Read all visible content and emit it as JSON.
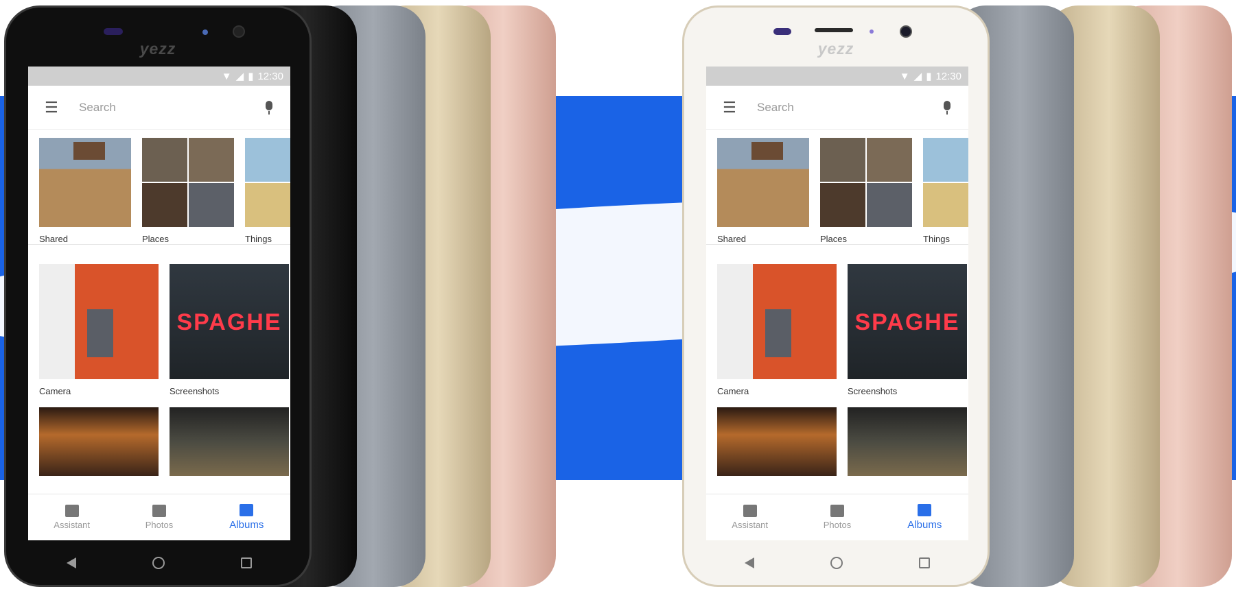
{
  "status_bar": {
    "time": "12:30"
  },
  "brand": "yezz",
  "search": {
    "placeholder": "Search"
  },
  "albums_top": [
    {
      "label": "Shared"
    },
    {
      "label": "Places"
    },
    {
      "label": "Things"
    }
  ],
  "albums_big": [
    {
      "label": "Camera"
    },
    {
      "label": "Screenshots"
    }
  ],
  "screenshot_sign": "SPAGHE",
  "bottom_nav": [
    {
      "label": "Assistant",
      "active": false
    },
    {
      "label": "Photos",
      "active": false
    },
    {
      "label": "Albums",
      "active": true
    }
  ],
  "colors": {
    "accent": "#2a6fe8",
    "background_blue": "#1a63e6",
    "variants": [
      "black",
      "grey",
      "gold",
      "rose gold",
      "white"
    ]
  }
}
